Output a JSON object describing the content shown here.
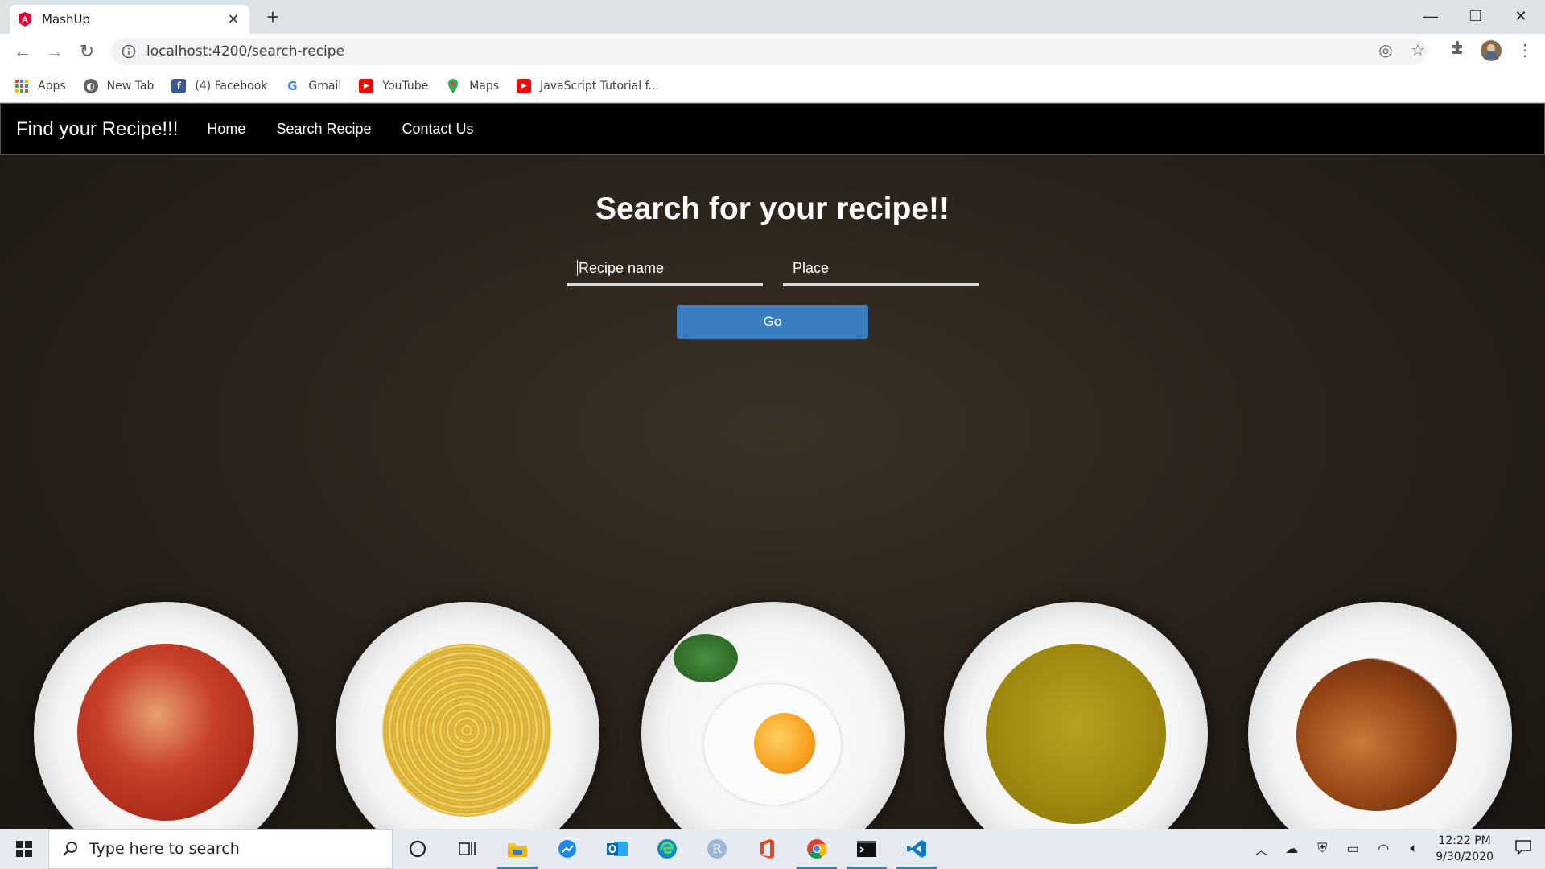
{
  "browser": {
    "tab_title": "MashUp",
    "url": "localhost:4200/search-recipe",
    "bookmarks": [
      {
        "label": "Apps",
        "icon": "apps-grid-icon"
      },
      {
        "label": "New Tab",
        "icon": "globe-icon"
      },
      {
        "label": "(4) Facebook",
        "icon": "facebook-icon"
      },
      {
        "label": "Gmail",
        "icon": "google-icon"
      },
      {
        "label": "YouTube",
        "icon": "youtube-icon"
      },
      {
        "label": "Maps",
        "icon": "maps-icon"
      },
      {
        "label": "JavaScript Tutorial f...",
        "icon": "youtube-icon"
      }
    ]
  },
  "navbar": {
    "brand": "Find your Recipe!!!",
    "links": [
      "Home",
      "Search Recipe",
      "Contact Us"
    ]
  },
  "search": {
    "heading": "Search for your recipe!!",
    "recipe_placeholder": "Recipe name",
    "place_placeholder": "Place",
    "go_label": "Go",
    "accent_color": "#3a7cc0"
  },
  "taskbar": {
    "search_placeholder": "Type here to search",
    "time": "12:22 PM",
    "date": "9/30/2020"
  }
}
